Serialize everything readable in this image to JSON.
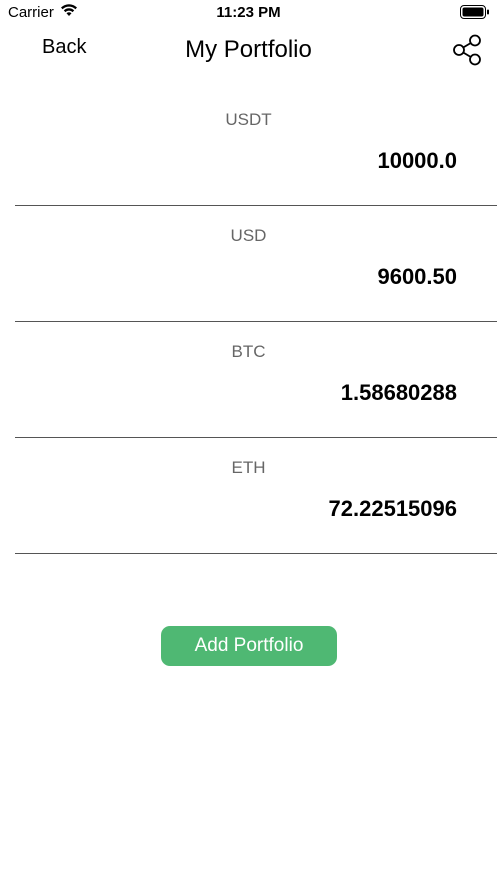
{
  "status_bar": {
    "carrier": "Carrier",
    "time": "11:23 PM",
    "wifi_icon": "wifi-icon",
    "battery_icon": "battery-icon"
  },
  "nav": {
    "back_label": "Back",
    "title": "My Portfolio",
    "share_icon": "share-icon"
  },
  "portfolio": [
    {
      "symbol": "USDT",
      "amount": "10000.0"
    },
    {
      "symbol": "USD",
      "amount": "9600.50"
    },
    {
      "symbol": "BTC",
      "amount": "1.58680288"
    },
    {
      "symbol": "ETH",
      "amount": "72.22515096"
    }
  ],
  "actions": {
    "add_label": "Add Portfolio"
  },
  "colors": {
    "accent": "#4fb873",
    "divider": "#555555",
    "label": "#666666"
  }
}
